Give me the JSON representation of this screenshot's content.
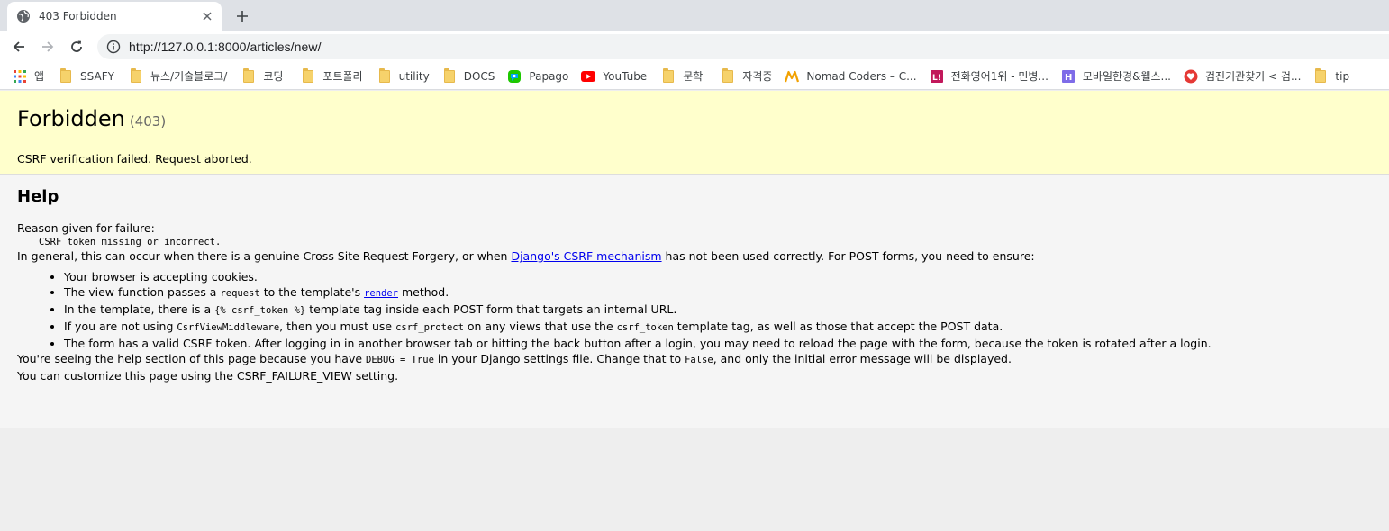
{
  "browser": {
    "tab": {
      "title": "403 Forbidden"
    },
    "address": {
      "url": "http://127.0.0.1:8000/articles/new/"
    },
    "bookmarks": [
      {
        "label": "앱",
        "icon": "apps-grid-icon"
      },
      {
        "label": "SSAFY",
        "icon": "folder-icon"
      },
      {
        "label": "뉴스/기술블로그/",
        "icon": "folder-icon"
      },
      {
        "label": "코딩",
        "icon": "folder-icon"
      },
      {
        "label": "포트폴리",
        "icon": "folder-icon"
      },
      {
        "label": "utility",
        "icon": "folder-icon"
      },
      {
        "label": "DOCS",
        "icon": "folder-icon"
      },
      {
        "label": "Papago",
        "icon": "papago-icon"
      },
      {
        "label": "YouTube",
        "icon": "youtube-icon"
      },
      {
        "label": "문학",
        "icon": "folder-icon"
      },
      {
        "label": "자격증",
        "icon": "folder-icon"
      },
      {
        "label": "Nomad Coders – C...",
        "icon": "nomad-coders-icon"
      },
      {
        "label": "전화영어1위 - 민병...",
        "icon": "site-icon-l"
      },
      {
        "label": "모바일한경&웰스...",
        "icon": "site-icon-h"
      },
      {
        "label": "검진기관찾기 < 검...",
        "icon": "heart-icon"
      },
      {
        "label": "tip",
        "icon": "folder-icon"
      }
    ]
  },
  "summary": {
    "title": "Forbidden",
    "code": "(403)",
    "message": "CSRF verification failed. Request aborted."
  },
  "help": {
    "heading": "Help",
    "reason_label": "Reason given for failure:",
    "reason": "CSRF token missing or incorrect.",
    "intro_before": "In general, this can occur when there is a genuine Cross Site Request Forgery, or when ",
    "intro_link": "Django's CSRF mechanism",
    "intro_after": " has not been used correctly. For POST forms, you need to ensure:",
    "li1": "Your browser is accepting cookies.",
    "li2_a": "The view function passes a ",
    "li2_code": "request",
    "li2_b": " to the template's ",
    "li2_link": "render",
    "li2_c": " method.",
    "li3_a": "In the template, there is a ",
    "li3_code": "{% csrf_token %}",
    "li3_b": " template tag inside each POST form that targets an internal URL.",
    "li4_a": "If you are not using ",
    "li4_code1": "CsrfViewMiddleware",
    "li4_b": ", then you must use ",
    "li4_code2": "csrf_protect",
    "li4_c": " on any views that use the ",
    "li4_code3": "csrf_token",
    "li4_d": " template tag, as well as those that accept the POST data.",
    "li5": "The form has a valid CSRF token. After logging in in another browser tab or hitting the back button after a login, you may need to reload the page with the form, because the token is rotated after a login.",
    "debug_a": "You're seeing the help section of this page because you have ",
    "debug_code1": "DEBUG = True",
    "debug_b": " in your Django settings file. Change that to ",
    "debug_code2": "False",
    "debug_c": ", and only the initial error message will be displayed.",
    "customize": "You can customize this page using the CSRF_FAILURE_VIEW setting."
  }
}
